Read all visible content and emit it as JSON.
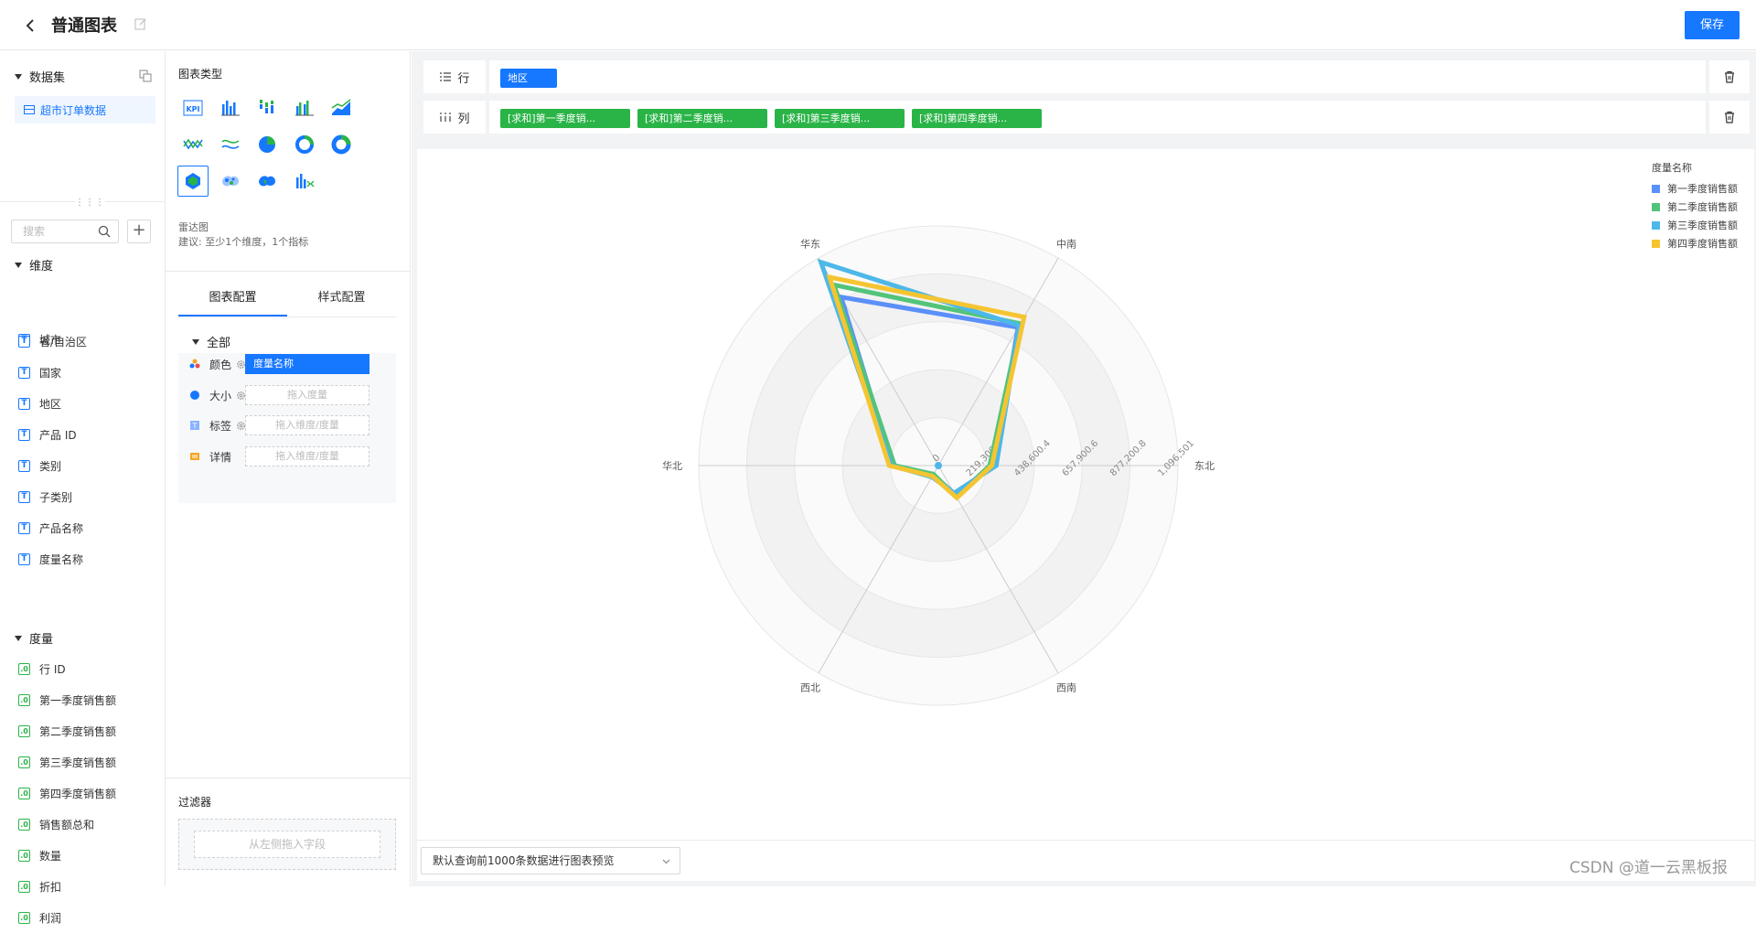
{
  "header": {
    "title": "普通图表",
    "save_label": "保存"
  },
  "dataset": {
    "section_label": "数据集",
    "selected": "超市订单数据"
  },
  "fields": {
    "search_placeholder": "搜索",
    "dimensions_label": "维度",
    "dimensions_cut": "城市",
    "dimensions": [
      "省/自治区",
      "国家",
      "地区",
      "产品 ID",
      "类别",
      "子类别",
      "产品名称",
      "度量名称"
    ],
    "measures_label": "度量",
    "measures": [
      "行 ID",
      "第一季度销售额",
      "第二季度销售额",
      "第三季度销售额",
      "第四季度销售额",
      "销售额总和",
      "数量",
      "折扣",
      "利润"
    ],
    "dim_icon": "T",
    "meas_icon": ".0"
  },
  "chart_types": {
    "title": "图表类型",
    "selected_name": "雷达图",
    "hint": "建议: 至少1个维度，1个指标",
    "icons": [
      "kpi-icon",
      "bar-chart-icon",
      "stacked-bar-icon",
      "grouped-bar-icon",
      "area-chart-icon",
      "line-chart-icon",
      "wave-line-icon",
      "pie-chart-icon",
      "ring-chart-icon",
      "donut-chart-icon",
      "radar-chart-icon",
      "scatter-map-icon",
      "bubble-map-icon",
      "combo-chart-icon"
    ]
  },
  "config": {
    "tabs": [
      "图表配置",
      "样式配置"
    ],
    "all_label": "全部",
    "rows": [
      {
        "label": "颜色",
        "slot": "度量名称",
        "filled": true
      },
      {
        "label": "大小",
        "slot": "拖入度量",
        "filled": false
      },
      {
        "label": "标签",
        "slot": "拖入维度/度量",
        "filled": false
      },
      {
        "label": "详情",
        "slot": "拖入维度/度量",
        "filled": false
      }
    ],
    "filter_label": "过滤器",
    "filter_placeholder": "从左侧拖入字段"
  },
  "shelves": {
    "row_label": "行",
    "row_pills": [
      "地区"
    ],
    "col_label": "列",
    "col_pills": [
      "[求和]第一季度销...",
      "[求和]第二季度销...",
      "[求和]第三季度销...",
      "[求和]第四季度销..."
    ]
  },
  "preview": {
    "label": "默认查询前1000条数据进行图表预览"
  },
  "watermark": "CSDN @道一云黑板报",
  "chart_data": {
    "type": "radar",
    "indicators": [
      "东北",
      "中南",
      "华东",
      "华北",
      "西北",
      "西南"
    ],
    "max": 1096501,
    "tick_labels": [
      "0",
      "219,300.2",
      "438,600.4",
      "657,900.6",
      "877,200.8",
      "1,096,501"
    ],
    "legend_title": "度量名称",
    "series": [
      {
        "name": "第一季度销售额",
        "color": "#5B8FF9",
        "values": [
          255000,
          730000,
          890000,
          210000,
          50000,
          150000
        ]
      },
      {
        "name": "第二季度销售额",
        "color": "#52C47A",
        "values": [
          235000,
          750000,
          955000,
          200000,
          45000,
          165000
        ]
      },
      {
        "name": "第三季度销售额",
        "color": "#4DB8E8",
        "values": [
          265000,
          740000,
          1075000,
          215000,
          60000,
          145000
        ]
      },
      {
        "name": "第四季度销售额",
        "color": "#F5C531",
        "values": [
          245000,
          785000,
          995000,
          225000,
          55000,
          170000
        ]
      }
    ]
  }
}
